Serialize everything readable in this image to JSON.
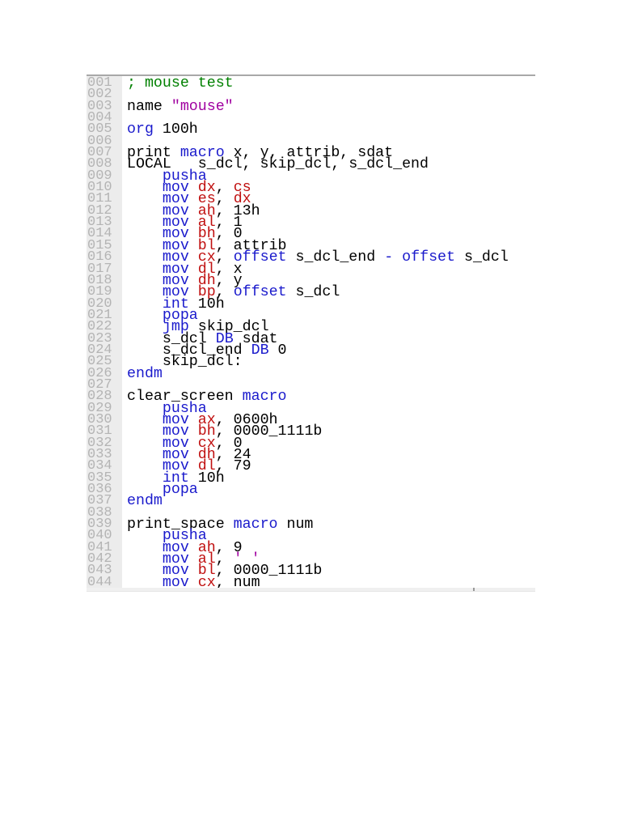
{
  "editor": {
    "lines": [
      {
        "no": "001",
        "tokens": [
          [
            "; mouse test",
            "c"
          ]
        ]
      },
      {
        "no": "002",
        "tokens": []
      },
      {
        "no": "003",
        "tokens": [
          [
            "name ",
            "n"
          ],
          [
            "\"mouse\"",
            "s"
          ]
        ]
      },
      {
        "no": "004",
        "tokens": []
      },
      {
        "no": "005",
        "tokens": [
          [
            "org",
            "k"
          ],
          [
            " 100h",
            "n"
          ]
        ]
      },
      {
        "no": "006",
        "tokens": []
      },
      {
        "no": "007",
        "tokens": [
          [
            "print ",
            "n"
          ],
          [
            "macro",
            "k"
          ],
          [
            " x, y, attrib, sdat",
            "n"
          ]
        ]
      },
      {
        "no": "008",
        "tokens": [
          [
            "LOCAL   s_dcl, skip_dcl, s_dcl_end",
            "n"
          ]
        ]
      },
      {
        "no": "009",
        "tokens": [
          [
            "    ",
            "n"
          ],
          [
            "pusha",
            "k"
          ]
        ]
      },
      {
        "no": "010",
        "tokens": [
          [
            "    ",
            "n"
          ],
          [
            "mov ",
            "k"
          ],
          [
            "dx",
            "r"
          ],
          [
            ", ",
            "n"
          ],
          [
            "cs",
            "r"
          ]
        ]
      },
      {
        "no": "011",
        "tokens": [
          [
            "    ",
            "n"
          ],
          [
            "mov ",
            "k"
          ],
          [
            "es",
            "r"
          ],
          [
            ", ",
            "n"
          ],
          [
            "dx",
            "r"
          ]
        ]
      },
      {
        "no": "012",
        "tokens": [
          [
            "    ",
            "n"
          ],
          [
            "mov ",
            "k"
          ],
          [
            "ah",
            "r"
          ],
          [
            ", 13h",
            "n"
          ]
        ]
      },
      {
        "no": "013",
        "tokens": [
          [
            "    ",
            "n"
          ],
          [
            "mov ",
            "k"
          ],
          [
            "al",
            "r"
          ],
          [
            ", 1",
            "n"
          ]
        ]
      },
      {
        "no": "014",
        "tokens": [
          [
            "    ",
            "n"
          ],
          [
            "mov ",
            "k"
          ],
          [
            "bh",
            "r"
          ],
          [
            ", 0",
            "n"
          ]
        ]
      },
      {
        "no": "015",
        "tokens": [
          [
            "    ",
            "n"
          ],
          [
            "mov ",
            "k"
          ],
          [
            "bl",
            "r"
          ],
          [
            ", attrib",
            "n"
          ]
        ]
      },
      {
        "no": "016",
        "tokens": [
          [
            "    ",
            "n"
          ],
          [
            "mov ",
            "k"
          ],
          [
            "cx",
            "r"
          ],
          [
            ", ",
            "n"
          ],
          [
            "offset",
            "k"
          ],
          [
            " s_dcl_end ",
            "n"
          ],
          [
            "-",
            "k"
          ],
          [
            " ",
            "n"
          ],
          [
            "offset",
            "k"
          ],
          [
            " s_dcl",
            "n"
          ]
        ]
      },
      {
        "no": "017",
        "tokens": [
          [
            "    ",
            "n"
          ],
          [
            "mov ",
            "k"
          ],
          [
            "dl",
            "r"
          ],
          [
            ", x",
            "n"
          ]
        ]
      },
      {
        "no": "018",
        "tokens": [
          [
            "    ",
            "n"
          ],
          [
            "mov ",
            "k"
          ],
          [
            "dh",
            "r"
          ],
          [
            ", y",
            "n"
          ]
        ]
      },
      {
        "no": "019",
        "tokens": [
          [
            "    ",
            "n"
          ],
          [
            "mov ",
            "k"
          ],
          [
            "bp",
            "r"
          ],
          [
            ", ",
            "n"
          ],
          [
            "offset",
            "k"
          ],
          [
            " s_dcl",
            "n"
          ]
        ]
      },
      {
        "no": "020",
        "tokens": [
          [
            "    ",
            "n"
          ],
          [
            "int",
            "k"
          ],
          [
            " 10h",
            "n"
          ]
        ]
      },
      {
        "no": "021",
        "tokens": [
          [
            "    ",
            "n"
          ],
          [
            "popa",
            "k"
          ]
        ]
      },
      {
        "no": "022",
        "tokens": [
          [
            "    ",
            "n"
          ],
          [
            "jmp",
            "k"
          ],
          [
            " skip_dcl",
            "n"
          ]
        ]
      },
      {
        "no": "023",
        "tokens": [
          [
            "    s_dcl ",
            "n"
          ],
          [
            "DB",
            "k"
          ],
          [
            " sdat",
            "n"
          ]
        ]
      },
      {
        "no": "024",
        "tokens": [
          [
            "    s_dcl_end ",
            "n"
          ],
          [
            "DB",
            "k"
          ],
          [
            " 0",
            "n"
          ]
        ]
      },
      {
        "no": "025",
        "tokens": [
          [
            "    skip_dcl:",
            "n"
          ]
        ]
      },
      {
        "no": "026",
        "tokens": [
          [
            "endm",
            "k"
          ]
        ]
      },
      {
        "no": "027",
        "tokens": []
      },
      {
        "no": "028",
        "tokens": [
          [
            "clear_screen ",
            "n"
          ],
          [
            "macro",
            "k"
          ]
        ]
      },
      {
        "no": "029",
        "tokens": [
          [
            "    ",
            "n"
          ],
          [
            "pusha",
            "k"
          ]
        ]
      },
      {
        "no": "030",
        "tokens": [
          [
            "    ",
            "n"
          ],
          [
            "mov ",
            "k"
          ],
          [
            "ax",
            "r"
          ],
          [
            ", 0600h",
            "n"
          ]
        ]
      },
      {
        "no": "031",
        "tokens": [
          [
            "    ",
            "n"
          ],
          [
            "mov ",
            "k"
          ],
          [
            "bh",
            "r"
          ],
          [
            ", 0000_1111b",
            "n"
          ]
        ]
      },
      {
        "no": "032",
        "tokens": [
          [
            "    ",
            "n"
          ],
          [
            "mov ",
            "k"
          ],
          [
            "cx",
            "r"
          ],
          [
            ", 0",
            "n"
          ]
        ]
      },
      {
        "no": "033",
        "tokens": [
          [
            "    ",
            "n"
          ],
          [
            "mov ",
            "k"
          ],
          [
            "dh",
            "r"
          ],
          [
            ", 24",
            "n"
          ]
        ]
      },
      {
        "no": "034",
        "tokens": [
          [
            "    ",
            "n"
          ],
          [
            "mov ",
            "k"
          ],
          [
            "dl",
            "r"
          ],
          [
            ", 79",
            "n"
          ]
        ]
      },
      {
        "no": "035",
        "tokens": [
          [
            "    ",
            "n"
          ],
          [
            "int",
            "k"
          ],
          [
            " 10h",
            "n"
          ]
        ]
      },
      {
        "no": "036",
        "tokens": [
          [
            "    ",
            "n"
          ],
          [
            "popa",
            "k"
          ]
        ]
      },
      {
        "no": "037",
        "tokens": [
          [
            "endm",
            "k"
          ]
        ]
      },
      {
        "no": "038",
        "tokens": []
      },
      {
        "no": "039",
        "tokens": [
          [
            "print_space ",
            "n"
          ],
          [
            "macro",
            "k"
          ],
          [
            " num",
            "n"
          ]
        ]
      },
      {
        "no": "040",
        "tokens": [
          [
            "    ",
            "n"
          ],
          [
            "pusha",
            "k"
          ]
        ]
      },
      {
        "no": "041",
        "tokens": [
          [
            "    ",
            "n"
          ],
          [
            "mov ",
            "k"
          ],
          [
            "ah",
            "r"
          ],
          [
            ", 9",
            "n"
          ]
        ]
      },
      {
        "no": "042",
        "tokens": [
          [
            "    ",
            "n"
          ],
          [
            "mov ",
            "k"
          ],
          [
            "al",
            "r"
          ],
          [
            ", ",
            "n"
          ],
          [
            "' '",
            "s"
          ]
        ]
      },
      {
        "no": "043",
        "tokens": [
          [
            "    ",
            "n"
          ],
          [
            "mov ",
            "k"
          ],
          [
            "bl",
            "r"
          ],
          [
            ", 0000_1111b",
            "n"
          ]
        ]
      },
      {
        "no": "044",
        "tokens": [
          [
            "    ",
            "n"
          ],
          [
            "mov ",
            "k"
          ],
          [
            "cx",
            "r"
          ],
          [
            ", num",
            "n"
          ]
        ]
      }
    ]
  }
}
